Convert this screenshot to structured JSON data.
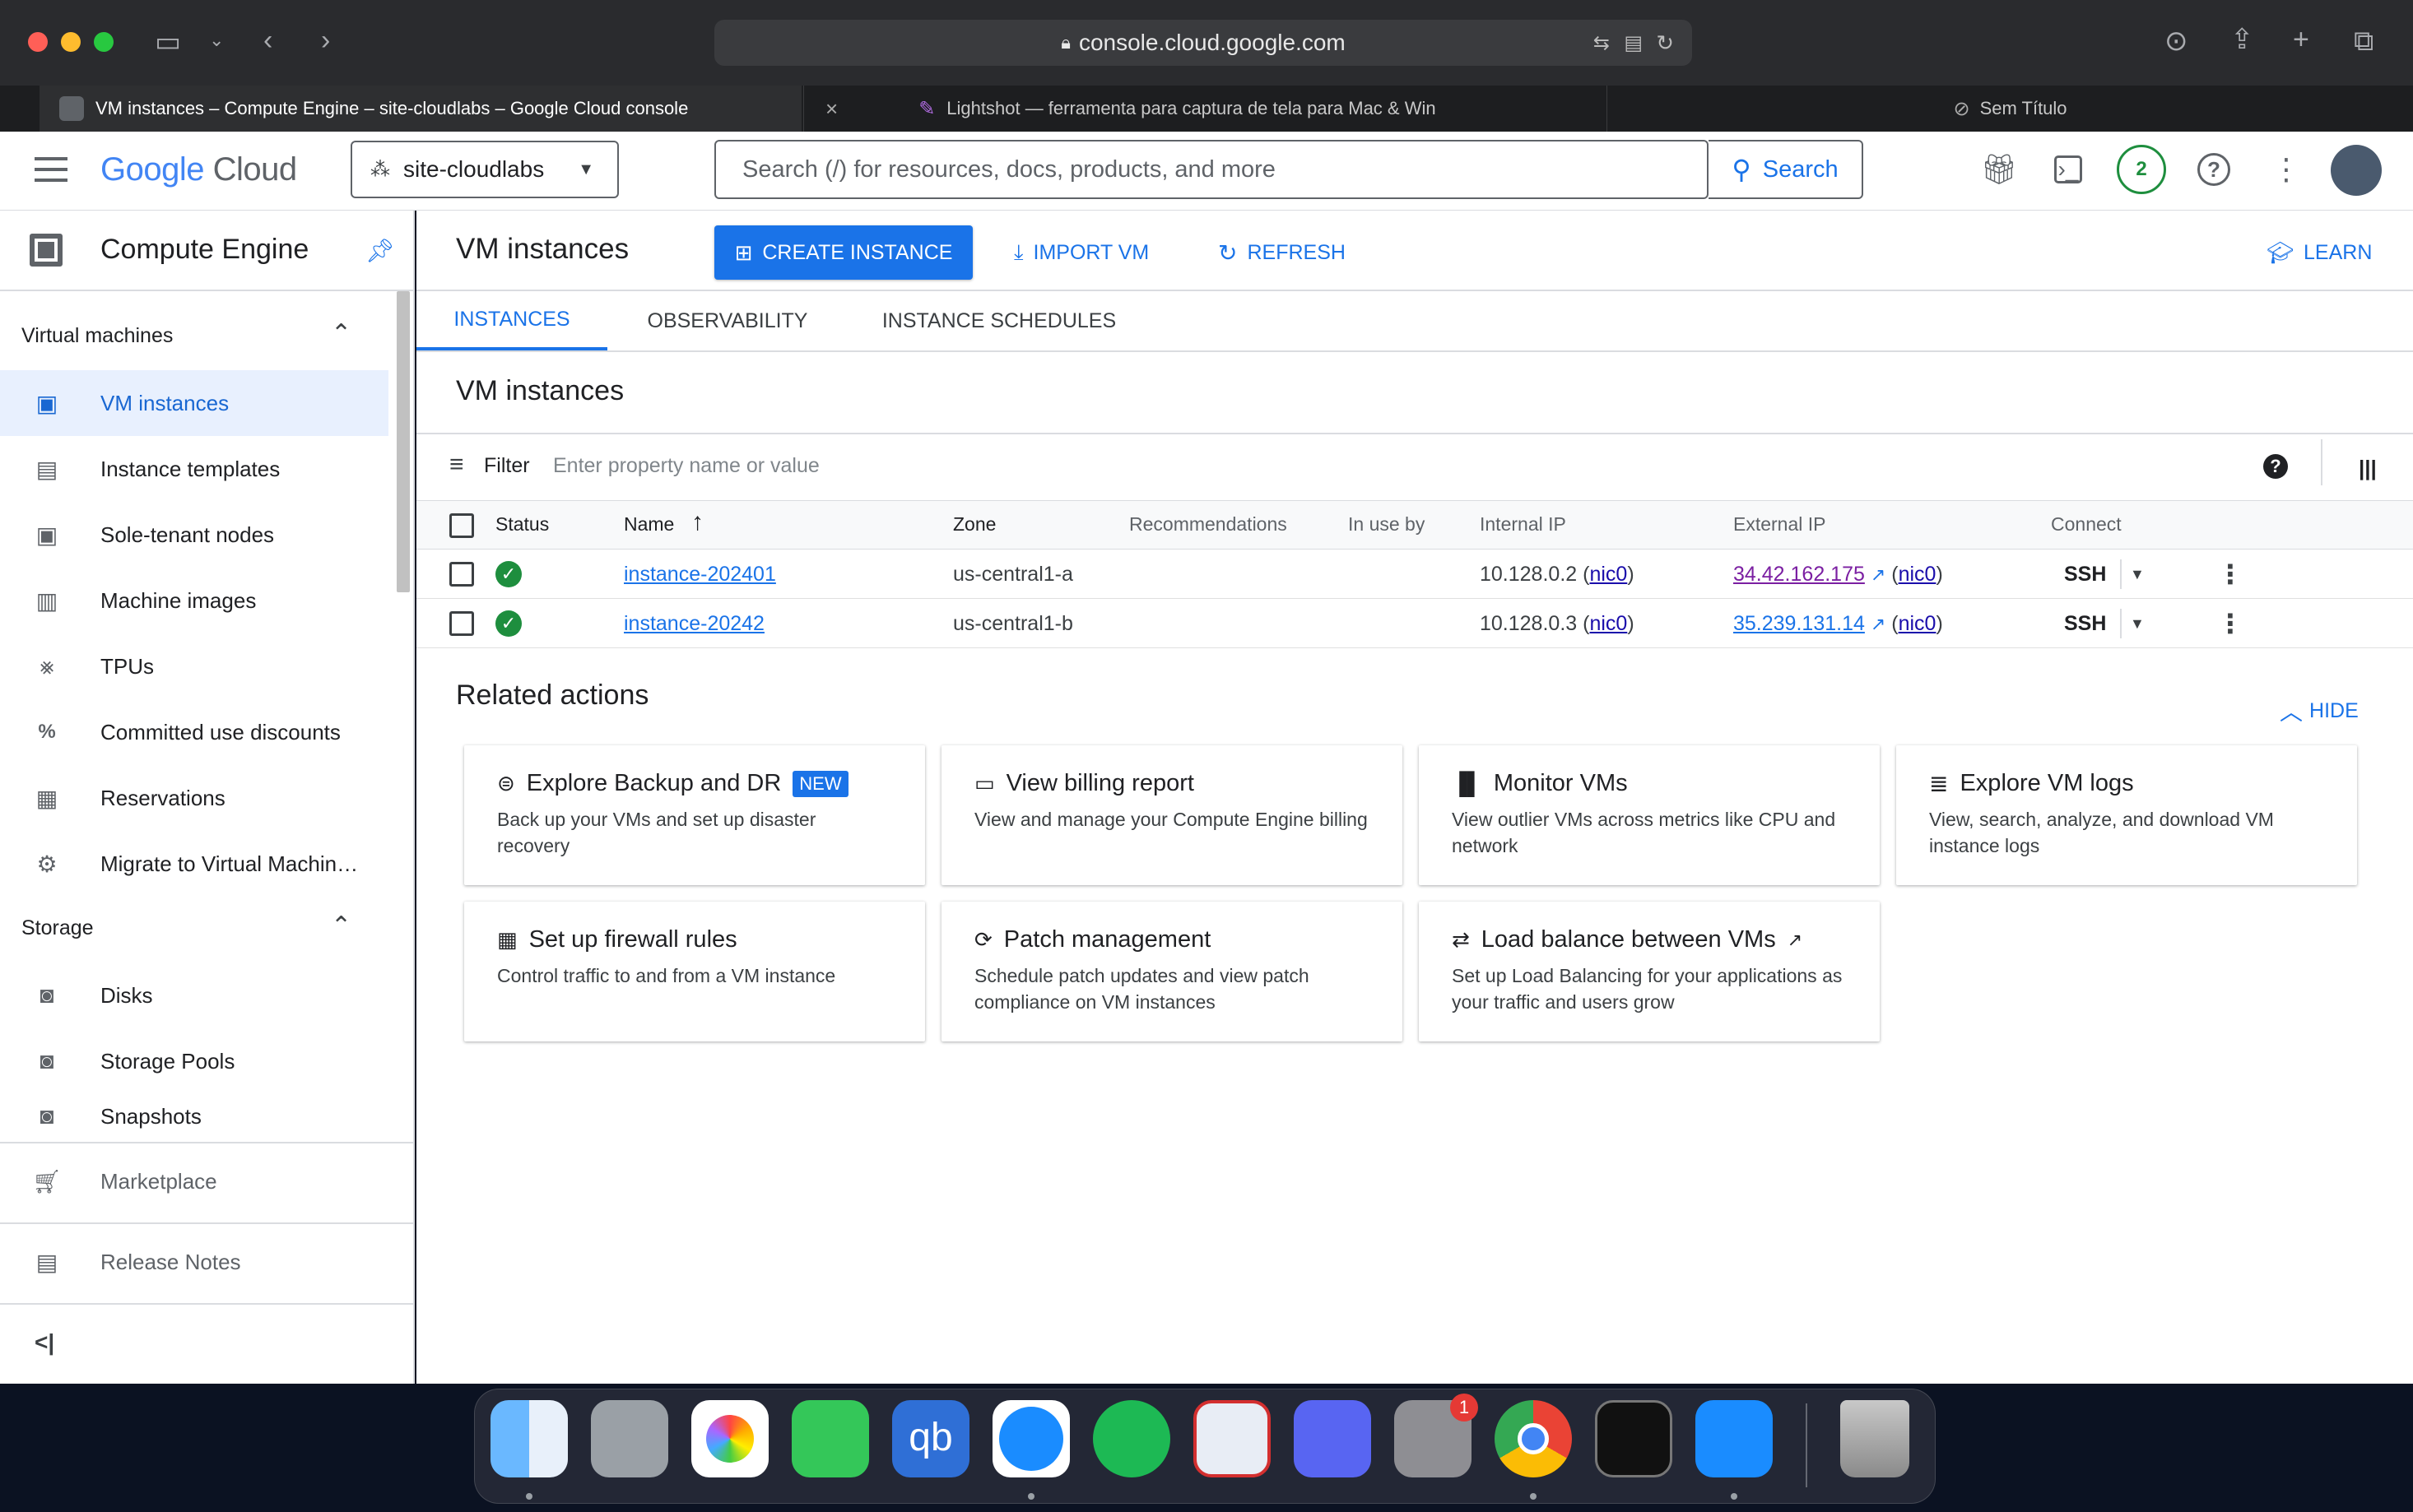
{
  "browser": {
    "url": "console.cloud.google.com",
    "tabs": [
      {
        "title": "VM instances – Compute Engine – site-cloudlabs – Google Cloud console"
      },
      {
        "title": "Lightshot — ferramenta para captura de tela para Mac & Win"
      },
      {
        "title": "Sem Título"
      }
    ]
  },
  "header": {
    "logo": {
      "google": "Google",
      "cloud": "Cloud"
    },
    "project": "site-cloudlabs",
    "search_placeholder": "Search (/) for resources, docs, products, and more",
    "search_button": "Search",
    "notification_count": "2"
  },
  "sidebar": {
    "product_title": "Compute Engine",
    "sections": [
      {
        "title": "Virtual machines",
        "items": [
          {
            "label": "VM instances",
            "icon": "vm-instance-icon",
            "active": true
          },
          {
            "label": "Instance templates",
            "icon": "template-icon"
          },
          {
            "label": "Sole-tenant nodes",
            "icon": "sole-tenant-icon"
          },
          {
            "label": "Machine images",
            "icon": "machine-image-icon"
          },
          {
            "label": "TPUs",
            "icon": "tpu-icon"
          },
          {
            "label": "Committed use discounts",
            "icon": "percent-icon"
          },
          {
            "label": "Reservations",
            "icon": "calendar-icon"
          },
          {
            "label": "Migrate to Virtual Machin…",
            "icon": "migrate-icon"
          }
        ]
      },
      {
        "title": "Storage",
        "items": [
          {
            "label": "Disks",
            "icon": "disk-icon"
          },
          {
            "label": "Storage Pools",
            "icon": "storage-pool-icon"
          },
          {
            "label": "Snapshots",
            "icon": "snapshot-icon"
          }
        ]
      }
    ],
    "footer": [
      {
        "label": "Marketplace",
        "icon": "cart-icon"
      },
      {
        "label": "Release Notes",
        "icon": "notes-icon"
      }
    ]
  },
  "main": {
    "page_title": "VM instances",
    "actions": {
      "create": "CREATE INSTANCE",
      "import": "IMPORT VM",
      "refresh": "REFRESH",
      "learn": "LEARN"
    },
    "tabs": [
      {
        "label": "INSTANCES",
        "active": true
      },
      {
        "label": "OBSERVABILITY"
      },
      {
        "label": "INSTANCE SCHEDULES"
      }
    ],
    "section_title": "VM instances",
    "filter": {
      "label": "Filter",
      "placeholder": "Enter property name or value"
    },
    "table": {
      "columns": [
        "Status",
        "Name",
        "Zone",
        "Recommendations",
        "In use by",
        "Internal IP",
        "External IP",
        "Connect"
      ],
      "rows": [
        {
          "name": "instance-202401",
          "zone": "us-central1-a",
          "internal_ip": "10.128.0.2",
          "internal_nic": "nic0",
          "external_ip": "34.42.162.175",
          "external_nic": "nic0",
          "connect": "SSH"
        },
        {
          "name": "instance-20242",
          "zone": "us-central1-b",
          "internal_ip": "10.128.0.3",
          "internal_nic": "nic0",
          "external_ip": "35.239.131.14",
          "external_nic": "nic0",
          "connect": "SSH"
        }
      ]
    },
    "related": {
      "title": "Related actions",
      "hide": "HIDE",
      "cards": [
        {
          "title": "Explore Backup and DR",
          "badge": "NEW",
          "desc": "Back up your VMs and set up disaster recovery",
          "icon": "backup-icon"
        },
        {
          "title": "View billing report",
          "desc": "View and manage your Compute Engine billing",
          "icon": "billing-icon"
        },
        {
          "title": "Monitor VMs",
          "desc": "View outlier VMs across metrics like CPU and network",
          "icon": "bar-chart-icon"
        },
        {
          "title": "Explore VM logs",
          "desc": "View, search, analyze, and download VM instance logs",
          "icon": "logs-icon"
        },
        {
          "title": "Set up firewall rules",
          "desc": "Control traffic to and from a VM instance",
          "icon": "firewall-icon"
        },
        {
          "title": "Patch management",
          "desc": "Schedule patch updates and view patch compliance on VM instances",
          "icon": "patch-icon"
        },
        {
          "title": "Load balance between VMs",
          "desc": "Set up Load Balancing for your applications as your traffic and users grow",
          "icon": "load-balance-icon"
        }
      ]
    }
  },
  "dock": {
    "apps": [
      "Finder",
      "Launchpad",
      "Photos",
      "FaceTime",
      "qBittorrent",
      "Safari",
      "Spotify",
      "Screens",
      "Discord",
      "System Settings",
      "Chrome",
      "Activity Monitor",
      "App Store",
      "Trash"
    ],
    "settings_badge": "1",
    "qb_label": "qb"
  },
  "colors": {
    "accent": "#1a73e8",
    "success": "#1e8e3e",
    "link": "#1a0dab"
  }
}
